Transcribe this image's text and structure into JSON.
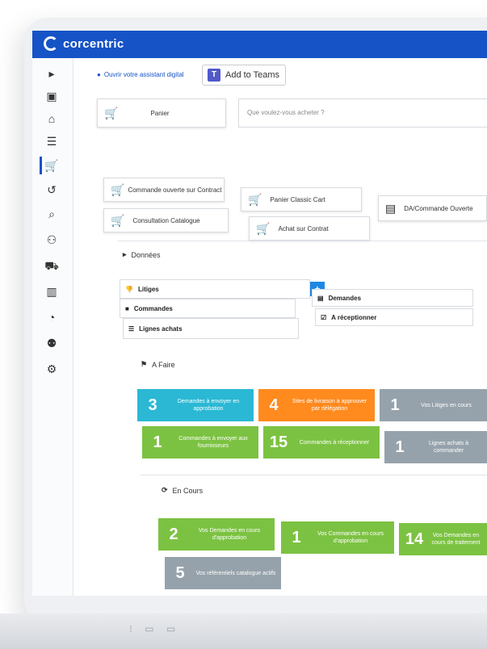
{
  "brand": {
    "name": "corcentric",
    "color": "#1553c7"
  },
  "sidebar": {
    "icons": [
      "expand-icon",
      "image-icon",
      "home-icon",
      "list-icon",
      "cart-icon",
      "return-icon",
      "search-doc-icon",
      "users-tree-icon",
      "truck-icon",
      "chart-icon",
      "dashboard-icon",
      "team-icon",
      "settings-icon"
    ],
    "glyphs": [
      "▸",
      "▣",
      "⌂",
      "☰",
      "🛒",
      "↺",
      "⌕",
      "⚇",
      "⛟",
      "▥",
      "◔",
      "⚉",
      "⚙"
    ]
  },
  "header": {
    "assistant_label": "Ouvrir votre assistant digital",
    "teams_label": "Add to Teams",
    "teams_glyph": "T"
  },
  "shortcuts": {
    "panier": "Panier",
    "search_placeholder": "Que voulez-vous acheter ?",
    "commande_ouverte": "Commande ouverte sur Contract",
    "panier_classic": "Panier Classic Cart",
    "da_commande": "DA/Commande Ouverte",
    "consultation": "Consultation Catalogue",
    "achat_contrat": "Achat sur Contrat"
  },
  "donnees": {
    "title": "Données",
    "litiges": "Litiges",
    "commandes": "Commandes",
    "lignes_achats": "Lignes achats",
    "demandes": "Demandes",
    "a_receptionner": "A réceptionner",
    "plus": "+"
  },
  "a_faire": {
    "title": "A Faire",
    "tiles": [
      {
        "num": "3",
        "label": "Demandes à envoyer en approbation"
      },
      {
        "num": "4",
        "label": "Sites de livraison à approuver par délégation"
      },
      {
        "num": "1",
        "label": "Vos Litiges en cours"
      },
      {
        "num": "1",
        "label": "Commandes à envoyer aux fournisseurs"
      },
      {
        "num": "15",
        "label": "Commandes à réceptionner"
      },
      {
        "num": "1",
        "label": "Lignes achats à commander"
      }
    ]
  },
  "en_cours": {
    "title": "En Cours",
    "tiles": [
      {
        "num": "2",
        "label": "Vos Demandes en cours d'approbation"
      },
      {
        "num": "1",
        "label": "Vos Commandes en cours d'approbation"
      },
      {
        "num": "14",
        "label": "Vos Demandes en cours de traitement"
      },
      {
        "num": "5",
        "label": "Vos référentiels catalogue actifs"
      }
    ]
  },
  "base": {
    "dots": "⁝ ▭ ▭"
  }
}
